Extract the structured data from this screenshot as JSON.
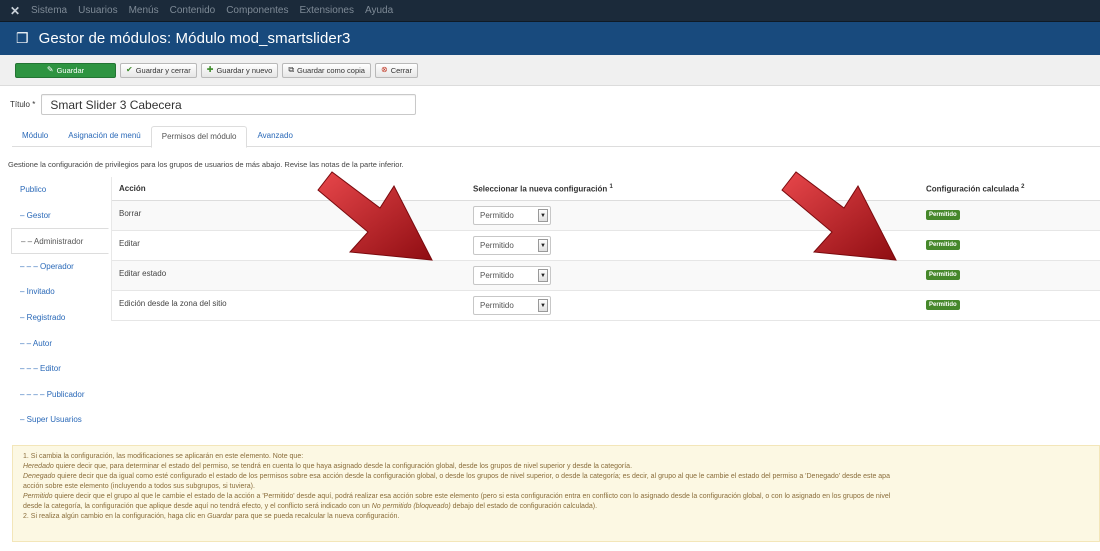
{
  "menubar": {
    "items": [
      "Sistema",
      "Usuarios",
      "Menús",
      "Contenido",
      "Componentes",
      "Extensiones",
      "Ayuda"
    ]
  },
  "header": {
    "title": "Gestor de módulos: Módulo mod_smartslider3"
  },
  "toolbar": {
    "save": "Guardar",
    "save_close": "Guardar y cerrar",
    "save_new": "Guardar y nuevo",
    "save_copy": "Guardar como copia",
    "close": "Cerrar"
  },
  "form": {
    "title_label": "Título *",
    "title_value": "Smart Slider 3 Cabecera"
  },
  "tabs": [
    "Módulo",
    "Asignación de menú",
    "Permisos del módulo",
    "Avanzado"
  ],
  "intro": "Gestione la configuración de privilegios para los grupos de usuarios de más abajo. Revise las notas de la parte inferior.",
  "groups": [
    "Publico",
    "– Gestor",
    "– – Administrador",
    "– – – Operador",
    "– Invitado",
    "– Registrado",
    "– – Autor",
    "– – – Editor",
    "– – – – Publicador",
    "– Super Usuarios"
  ],
  "table": {
    "col_action": "Acción",
    "col_new": "Seleccionar la nueva configuración",
    "col_new_sup": "1",
    "col_calc": "Configuración calculada",
    "col_calc_sup": "2",
    "rows": [
      {
        "action": "Borrar",
        "select": "Permitido",
        "calc": "Permitido"
      },
      {
        "action": "Editar",
        "select": "Permitido",
        "calc": "Permitido"
      },
      {
        "action": "Editar estado",
        "select": "Permitido",
        "calc": "Permitido"
      },
      {
        "action": "Edición desde la zona del sitio",
        "select": "Permitido",
        "calc": "Permitido"
      }
    ]
  },
  "notes": {
    "n1": "1. Si cambia la configuración, las modificaciones se aplicarán en este elemento. Note que:",
    "heredado_term": "Heredado",
    "heredado_text": " quiere decir que, para determinar el estado del permiso, se tendrá en cuenta lo que haya asignado desde la configuración global, desde los grupos de nivel superior y desde la categoría.",
    "denegado_term": "Denegado",
    "denegado_text": " quiere decir que da igual como esté configurado el estado de los permisos sobre esa acción desde la configuración global, o desde los grupos de nivel superior, o desde la categoría; es decir, al grupo al que le cambie el estado del permiso a 'Denegado' desde este apa",
    "denegado_cont": "acción sobre este elemento (incluyendo a todos sus subgrupos, si tuviera).",
    "permitido_term": "Permitido",
    "permitido_text": " quiere decir que el grupo al que le cambie el estado de la acción a 'Permitido' desde aquí, podrá realizar esa acción sobre este elemento (pero si esta configuración entra en conflicto con lo asignado desde la configuración global, o con lo asignado en los grupos de nivel",
    "permitido_cont_a": "desde la categoría, la configuración que aplique desde aquí no tendrá efecto, y el conflicto será indicado con un ",
    "permitido_cont_em": "No permitido (bloqueado)",
    "permitido_cont_b": " debajo del estado de configuración calculada).",
    "n2_a": "2. Si realiza algún cambio en la configuración, haga clic en ",
    "n2_em": "Guardar",
    "n2_b": " para que se pueda recalcular la nueva configuración."
  },
  "colors": {
    "menubar": "#1b2a3a",
    "header": "#184a7d",
    "save": "#2e9441",
    "badge": "#46882b",
    "link": "#2a69b8",
    "arrow": "#c0161c",
    "notes_bg": "#fcf8e3"
  },
  "icons": [
    "joomla-icon",
    "cube-icon",
    "edit-icon",
    "check-icon",
    "plus-icon",
    "copy-icon",
    "cancel-icon",
    "arrow-annotation"
  ]
}
